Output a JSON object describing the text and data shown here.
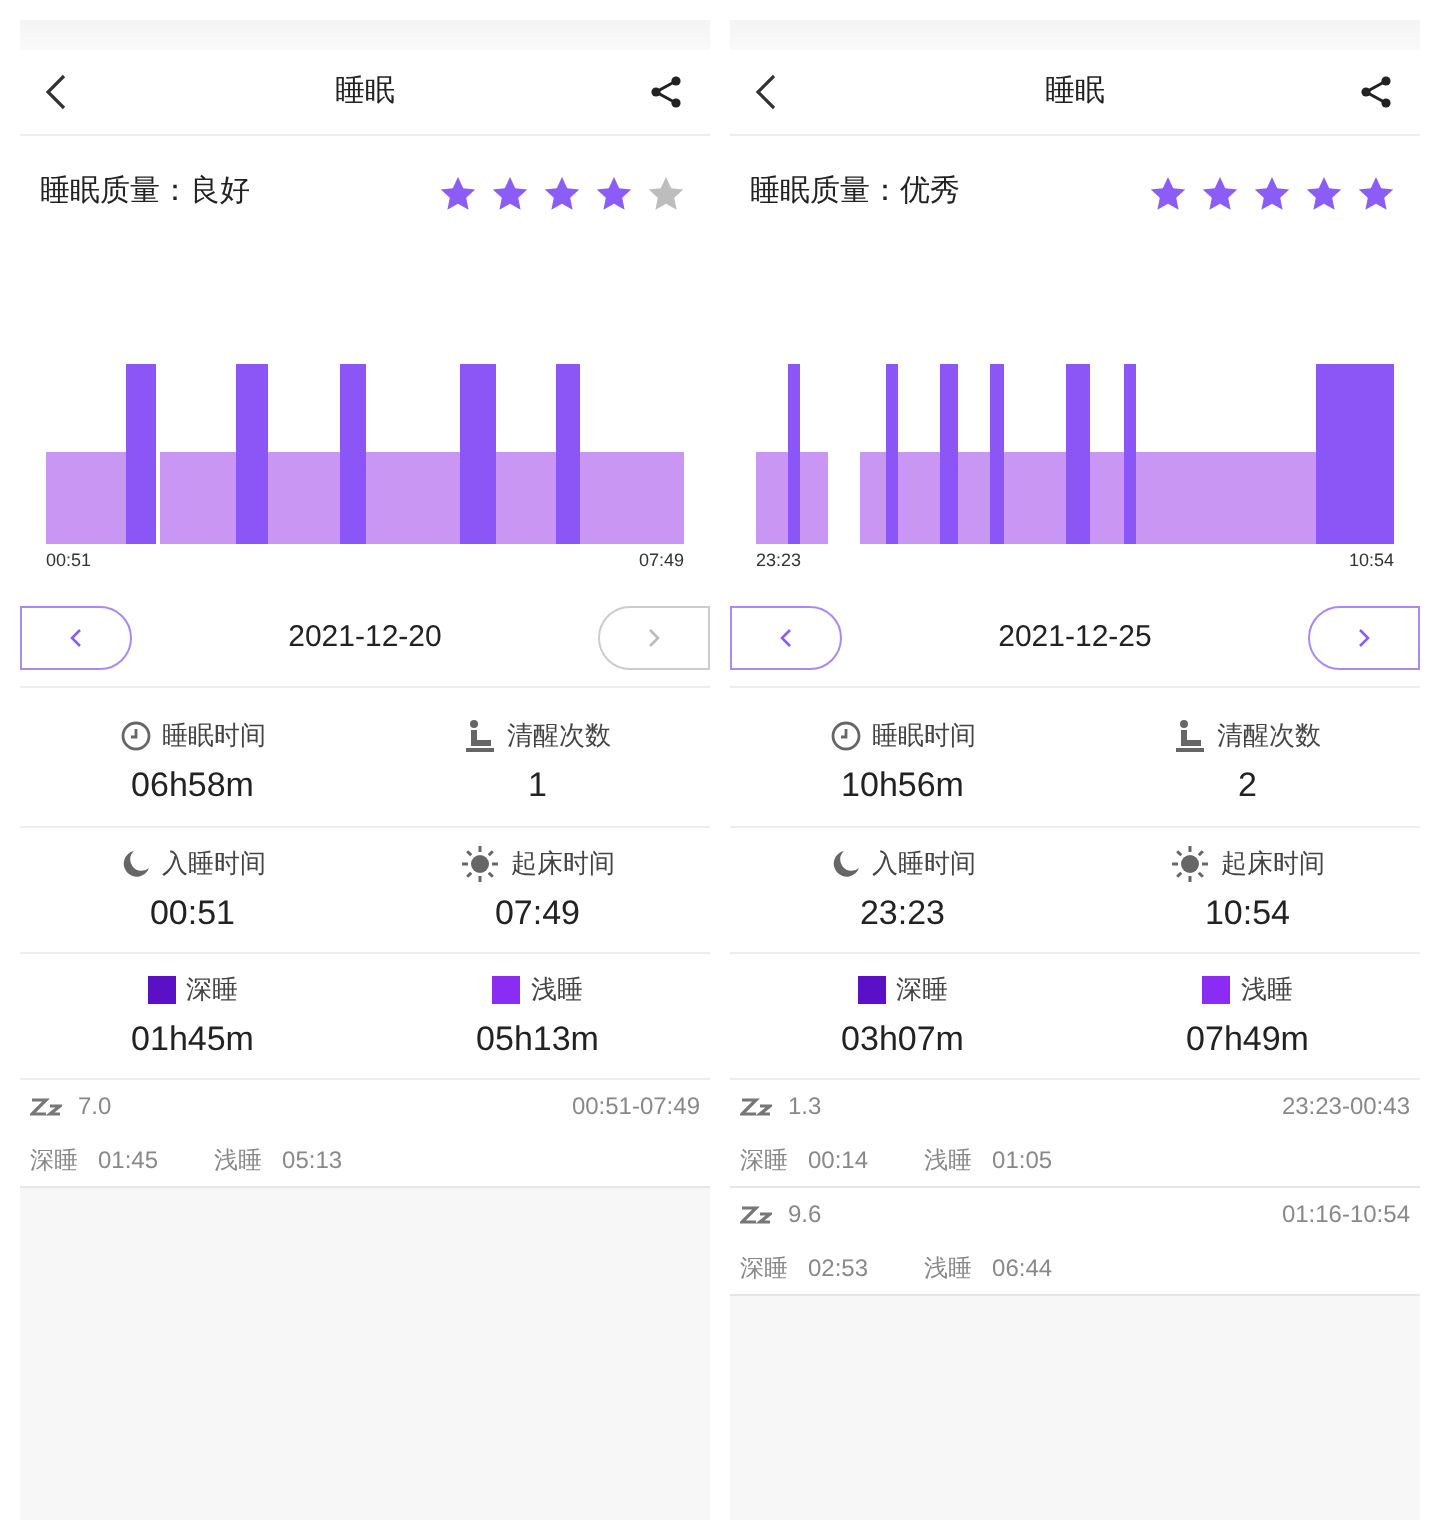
{
  "panels": [
    {
      "title": "睡眠",
      "quality": "睡眠质量：良好",
      "stars": 4,
      "chart": {
        "start_label": "00:51",
        "end_label": "07:49"
      },
      "date_nav": {
        "date": "2021-12-20",
        "prev": {
          "disabled": false
        },
        "next": {
          "disabled": true
        }
      },
      "stats": [
        {
          "kind": "clock",
          "label": "睡眠时间",
          "value": "06h58m"
        },
        {
          "kind": "wake",
          "label": "清醒次数",
          "value": "1"
        },
        {
          "kind": "moon",
          "label": "入睡时间",
          "value": "00:51"
        },
        {
          "kind": "sun",
          "label": "起床时间",
          "value": "07:49"
        },
        {
          "kind": "legend",
          "color": "#5b0fc7",
          "label": "深睡",
          "value": "01h45m"
        },
        {
          "kind": "legend",
          "color": "#8a2cf4",
          "label": "浅睡",
          "value": "05h13m"
        }
      ],
      "sessions": [
        {
          "score": "7.0",
          "range": "00:51-07:49",
          "deep_label": "深睡",
          "deep": "01:45",
          "light_label": "浅睡",
          "light": "05:13"
        }
      ]
    },
    {
      "title": "睡眠",
      "quality": "睡眠质量：优秀",
      "stars": 5,
      "chart": {
        "start_label": "23:23",
        "end_label": "10:54"
      },
      "date_nav": {
        "date": "2021-12-25",
        "prev": {
          "disabled": false
        },
        "next": {
          "disabled": false
        }
      },
      "stats": [
        {
          "kind": "clock",
          "label": "睡眠时间",
          "value": "10h56m"
        },
        {
          "kind": "wake",
          "label": "清醒次数",
          "value": "2"
        },
        {
          "kind": "moon",
          "label": "入睡时间",
          "value": "23:23"
        },
        {
          "kind": "sun",
          "label": "起床时间",
          "value": "10:54"
        },
        {
          "kind": "legend",
          "color": "#5b0fc7",
          "label": "深睡",
          "value": "03h07m"
        },
        {
          "kind": "legend",
          "color": "#8a2cf4",
          "label": "浅睡",
          "value": "07h49m"
        }
      ],
      "sessions": [
        {
          "score": "1.3",
          "range": "23:23-00:43",
          "deep_label": "深睡",
          "deep": "00:14",
          "light_label": "浅睡",
          "light": "01:05"
        },
        {
          "score": "9.6",
          "range": "01:16-10:54",
          "deep_label": "深睡",
          "deep": "02:53",
          "light_label": "浅睡",
          "light": "06:44"
        }
      ]
    }
  ]
}
